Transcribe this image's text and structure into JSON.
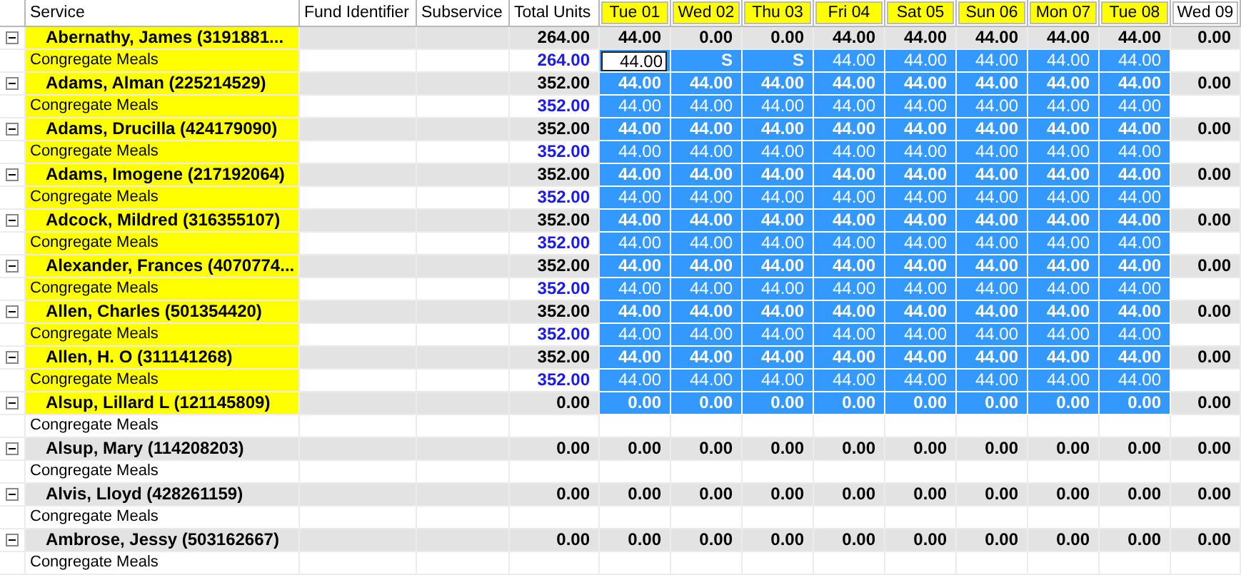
{
  "columns": {
    "service": "Service",
    "fund": "Fund Identifier",
    "subservice": "Subservice",
    "total": "Total Units"
  },
  "days": [
    {
      "label": "Tue 01",
      "highlighted": true
    },
    {
      "label": "Wed 02",
      "highlighted": true
    },
    {
      "label": "Thu 03",
      "highlighted": true
    },
    {
      "label": "Fri 04",
      "highlighted": true
    },
    {
      "label": "Sat 05",
      "highlighted": true
    },
    {
      "label": "Sun 06",
      "highlighted": true
    },
    {
      "label": "Mon 07",
      "highlighted": true
    },
    {
      "label": "Tue 08",
      "highlighted": true
    },
    {
      "label": "Wed 09",
      "highlighted": false
    }
  ],
  "groups": [
    {
      "name": "Abernathy, James (3191881...",
      "expanded": true,
      "highlighted": true,
      "total": "264.00",
      "cells": [
        {
          "value": "44.00",
          "selected": false
        },
        {
          "value": "0.00",
          "selected": false
        },
        {
          "value": "0.00",
          "selected": false
        },
        {
          "value": "44.00",
          "selected": false
        },
        {
          "value": "44.00",
          "selected": false
        },
        {
          "value": "44.00",
          "selected": false
        },
        {
          "value": "44.00",
          "selected": false
        },
        {
          "value": "44.00",
          "selected": false
        },
        {
          "value": "0.00",
          "selected": false
        }
      ],
      "detail": {
        "service": "Congregate Meals",
        "highlighted": true,
        "total": "264.00",
        "cells": [
          {
            "value": "44.00",
            "selected": true,
            "editing": true
          },
          {
            "value": "S",
            "selected": true
          },
          {
            "value": "S",
            "selected": true
          },
          {
            "value": "44.00",
            "selected": true
          },
          {
            "value": "44.00",
            "selected": true
          },
          {
            "value": "44.00",
            "selected": true
          },
          {
            "value": "44.00",
            "selected": true
          },
          {
            "value": "44.00",
            "selected": true
          },
          {
            "selected": false
          }
        ]
      }
    },
    {
      "name": "Adams, Alman (225214529)",
      "expanded": true,
      "highlighted": true,
      "total": "352.00",
      "cells": [
        {
          "value": "44.00",
          "selected": true
        },
        {
          "value": "44.00",
          "selected": true
        },
        {
          "value": "44.00",
          "selected": true
        },
        {
          "value": "44.00",
          "selected": true
        },
        {
          "value": "44.00",
          "selected": true
        },
        {
          "value": "44.00",
          "selected": true
        },
        {
          "value": "44.00",
          "selected": true
        },
        {
          "value": "44.00",
          "selected": true
        },
        {
          "value": "0.00",
          "selected": false
        }
      ],
      "detail": {
        "service": "Congregate Meals",
        "highlighted": true,
        "total": "352.00",
        "cells": [
          {
            "value": "44.00",
            "selected": true
          },
          {
            "value": "44.00",
            "selected": true
          },
          {
            "value": "44.00",
            "selected": true
          },
          {
            "value": "44.00",
            "selected": true
          },
          {
            "value": "44.00",
            "selected": true
          },
          {
            "value": "44.00",
            "selected": true
          },
          {
            "value": "44.00",
            "selected": true
          },
          {
            "value": "44.00",
            "selected": true
          },
          {
            "selected": false
          }
        ]
      }
    },
    {
      "name": "Adams, Drucilla (424179090)",
      "expanded": true,
      "highlighted": true,
      "total": "352.00",
      "cells": [
        {
          "value": "44.00",
          "selected": true
        },
        {
          "value": "44.00",
          "selected": true
        },
        {
          "value": "44.00",
          "selected": true
        },
        {
          "value": "44.00",
          "selected": true
        },
        {
          "value": "44.00",
          "selected": true
        },
        {
          "value": "44.00",
          "selected": true
        },
        {
          "value": "44.00",
          "selected": true
        },
        {
          "value": "44.00",
          "selected": true
        },
        {
          "value": "0.00",
          "selected": false
        }
      ],
      "detail": {
        "service": "Congregate Meals",
        "highlighted": true,
        "total": "352.00",
        "cells": [
          {
            "value": "44.00",
            "selected": true
          },
          {
            "value": "44.00",
            "selected": true
          },
          {
            "value": "44.00",
            "selected": true
          },
          {
            "value": "44.00",
            "selected": true
          },
          {
            "value": "44.00",
            "selected": true
          },
          {
            "value": "44.00",
            "selected": true
          },
          {
            "value": "44.00",
            "selected": true
          },
          {
            "value": "44.00",
            "selected": true
          },
          {
            "selected": false
          }
        ]
      }
    },
    {
      "name": "Adams, Imogene (217192064)",
      "expanded": true,
      "highlighted": true,
      "total": "352.00",
      "cells": [
        {
          "value": "44.00",
          "selected": true
        },
        {
          "value": "44.00",
          "selected": true
        },
        {
          "value": "44.00",
          "selected": true
        },
        {
          "value": "44.00",
          "selected": true
        },
        {
          "value": "44.00",
          "selected": true
        },
        {
          "value": "44.00",
          "selected": true
        },
        {
          "value": "44.00",
          "selected": true
        },
        {
          "value": "44.00",
          "selected": true
        },
        {
          "value": "0.00",
          "selected": false
        }
      ],
      "detail": {
        "service": "Congregate Meals",
        "highlighted": true,
        "total": "352.00",
        "cells": [
          {
            "value": "44.00",
            "selected": true
          },
          {
            "value": "44.00",
            "selected": true
          },
          {
            "value": "44.00",
            "selected": true
          },
          {
            "value": "44.00",
            "selected": true
          },
          {
            "value": "44.00",
            "selected": true
          },
          {
            "value": "44.00",
            "selected": true
          },
          {
            "value": "44.00",
            "selected": true
          },
          {
            "value": "44.00",
            "selected": true
          },
          {
            "selected": false
          }
        ]
      }
    },
    {
      "name": "Adcock, Mildred (316355107)",
      "expanded": true,
      "highlighted": true,
      "total": "352.00",
      "cells": [
        {
          "value": "44.00",
          "selected": true
        },
        {
          "value": "44.00",
          "selected": true
        },
        {
          "value": "44.00",
          "selected": true
        },
        {
          "value": "44.00",
          "selected": true
        },
        {
          "value": "44.00",
          "selected": true
        },
        {
          "value": "44.00",
          "selected": true
        },
        {
          "value": "44.00",
          "selected": true
        },
        {
          "value": "44.00",
          "selected": true
        },
        {
          "value": "0.00",
          "selected": false
        }
      ],
      "detail": {
        "service": "Congregate Meals",
        "highlighted": true,
        "total": "352.00",
        "cells": [
          {
            "value": "44.00",
            "selected": true
          },
          {
            "value": "44.00",
            "selected": true
          },
          {
            "value": "44.00",
            "selected": true
          },
          {
            "value": "44.00",
            "selected": true
          },
          {
            "value": "44.00",
            "selected": true
          },
          {
            "value": "44.00",
            "selected": true
          },
          {
            "value": "44.00",
            "selected": true
          },
          {
            "value": "44.00",
            "selected": true
          },
          {
            "selected": false
          }
        ]
      }
    },
    {
      "name": "Alexander, Frances (4070774...",
      "expanded": true,
      "highlighted": true,
      "total": "352.00",
      "cells": [
        {
          "value": "44.00",
          "selected": true
        },
        {
          "value": "44.00",
          "selected": true
        },
        {
          "value": "44.00",
          "selected": true
        },
        {
          "value": "44.00",
          "selected": true
        },
        {
          "value": "44.00",
          "selected": true
        },
        {
          "value": "44.00",
          "selected": true
        },
        {
          "value": "44.00",
          "selected": true
        },
        {
          "value": "44.00",
          "selected": true
        },
        {
          "value": "0.00",
          "selected": false
        }
      ],
      "detail": {
        "service": "Congregate Meals",
        "highlighted": true,
        "total": "352.00",
        "cells": [
          {
            "value": "44.00",
            "selected": true
          },
          {
            "value": "44.00",
            "selected": true
          },
          {
            "value": "44.00",
            "selected": true
          },
          {
            "value": "44.00",
            "selected": true
          },
          {
            "value": "44.00",
            "selected": true
          },
          {
            "value": "44.00",
            "selected": true
          },
          {
            "value": "44.00",
            "selected": true
          },
          {
            "value": "44.00",
            "selected": true
          },
          {
            "selected": false
          }
        ]
      }
    },
    {
      "name": "Allen, Charles (501354420)",
      "expanded": true,
      "highlighted": true,
      "total": "352.00",
      "cells": [
        {
          "value": "44.00",
          "selected": true
        },
        {
          "value": "44.00",
          "selected": true
        },
        {
          "value": "44.00",
          "selected": true
        },
        {
          "value": "44.00",
          "selected": true
        },
        {
          "value": "44.00",
          "selected": true
        },
        {
          "value": "44.00",
          "selected": true
        },
        {
          "value": "44.00",
          "selected": true
        },
        {
          "value": "44.00",
          "selected": true
        },
        {
          "value": "0.00",
          "selected": false
        }
      ],
      "detail": {
        "service": "Congregate Meals",
        "highlighted": true,
        "total": "352.00",
        "cells": [
          {
            "value": "44.00",
            "selected": true
          },
          {
            "value": "44.00",
            "selected": true
          },
          {
            "value": "44.00",
            "selected": true
          },
          {
            "value": "44.00",
            "selected": true
          },
          {
            "value": "44.00",
            "selected": true
          },
          {
            "value": "44.00",
            "selected": true
          },
          {
            "value": "44.00",
            "selected": true
          },
          {
            "value": "44.00",
            "selected": true
          },
          {
            "selected": false
          }
        ]
      }
    },
    {
      "name": "Allen, H. O (311141268)",
      "expanded": true,
      "highlighted": true,
      "total": "352.00",
      "cells": [
        {
          "value": "44.00",
          "selected": true
        },
        {
          "value": "44.00",
          "selected": true
        },
        {
          "value": "44.00",
          "selected": true
        },
        {
          "value": "44.00",
          "selected": true
        },
        {
          "value": "44.00",
          "selected": true
        },
        {
          "value": "44.00",
          "selected": true
        },
        {
          "value": "44.00",
          "selected": true
        },
        {
          "value": "44.00",
          "selected": true
        },
        {
          "value": "0.00",
          "selected": false
        }
      ],
      "detail": {
        "service": "Congregate Meals",
        "highlighted": true,
        "total": "352.00",
        "cells": [
          {
            "value": "44.00",
            "selected": true
          },
          {
            "value": "44.00",
            "selected": true
          },
          {
            "value": "44.00",
            "selected": true
          },
          {
            "value": "44.00",
            "selected": true
          },
          {
            "value": "44.00",
            "selected": true
          },
          {
            "value": "44.00",
            "selected": true
          },
          {
            "value": "44.00",
            "selected": true
          },
          {
            "value": "44.00",
            "selected": true
          },
          {
            "selected": false
          }
        ]
      }
    },
    {
      "name": "Alsup, Lillard L (121145809)",
      "expanded": true,
      "highlighted": true,
      "total": "0.00",
      "cells": [
        {
          "value": "0.00",
          "selected": true
        },
        {
          "value": "0.00",
          "selected": true
        },
        {
          "value": "0.00",
          "selected": true
        },
        {
          "value": "0.00",
          "selected": true
        },
        {
          "value": "0.00",
          "selected": true
        },
        {
          "value": "0.00",
          "selected": true
        },
        {
          "value": "0.00",
          "selected": true
        },
        {
          "value": "0.00",
          "selected": true
        },
        {
          "value": "0.00",
          "selected": false
        }
      ],
      "detail": {
        "service": "Congregate Meals",
        "highlighted": false,
        "cells": [
          {
            "selected": false
          },
          {
            "selected": false
          },
          {
            "selected": false
          },
          {
            "selected": false
          },
          {
            "selected": false
          },
          {
            "selected": false
          },
          {
            "selected": false
          },
          {
            "selected": false
          },
          {
            "selected": false
          }
        ]
      }
    },
    {
      "name": "Alsup, Mary (114208203)",
      "expanded": true,
      "highlighted": false,
      "total": "0.00",
      "cells": [
        {
          "value": "0.00",
          "selected": false
        },
        {
          "value": "0.00",
          "selected": false
        },
        {
          "value": "0.00",
          "selected": false
        },
        {
          "value": "0.00",
          "selected": false
        },
        {
          "value": "0.00",
          "selected": false
        },
        {
          "value": "0.00",
          "selected": false
        },
        {
          "value": "0.00",
          "selected": false
        },
        {
          "value": "0.00",
          "selected": false
        },
        {
          "value": "0.00",
          "selected": false
        }
      ],
      "detail": {
        "service": "Congregate Meals",
        "highlighted": false,
        "cells": [
          {
            "selected": false
          },
          {
            "selected": false
          },
          {
            "selected": false
          },
          {
            "selected": false
          },
          {
            "selected": false
          },
          {
            "selected": false
          },
          {
            "selected": false
          },
          {
            "selected": false
          },
          {
            "selected": false
          }
        ]
      }
    },
    {
      "name": "Alvis, Lloyd (428261159)",
      "expanded": true,
      "highlighted": false,
      "total": "0.00",
      "cells": [
        {
          "value": "0.00",
          "selected": false
        },
        {
          "value": "0.00",
          "selected": false
        },
        {
          "value": "0.00",
          "selected": false
        },
        {
          "value": "0.00",
          "selected": false
        },
        {
          "value": "0.00",
          "selected": false
        },
        {
          "value": "0.00",
          "selected": false
        },
        {
          "value": "0.00",
          "selected": false
        },
        {
          "value": "0.00",
          "selected": false
        },
        {
          "value": "0.00",
          "selected": false
        }
      ],
      "detail": {
        "service": "Congregate Meals",
        "highlighted": false,
        "cells": [
          {
            "selected": false
          },
          {
            "selected": false
          },
          {
            "selected": false
          },
          {
            "selected": false
          },
          {
            "selected": false
          },
          {
            "selected": false
          },
          {
            "selected": false
          },
          {
            "selected": false
          },
          {
            "selected": false
          }
        ]
      }
    },
    {
      "name": "Ambrose, Jessy (503162667)",
      "expanded": true,
      "highlighted": false,
      "total": "0.00",
      "cells": [
        {
          "value": "0.00",
          "selected": false
        },
        {
          "value": "0.00",
          "selected": false
        },
        {
          "value": "0.00",
          "selected": false
        },
        {
          "value": "0.00",
          "selected": false
        },
        {
          "value": "0.00",
          "selected": false
        },
        {
          "value": "0.00",
          "selected": false
        },
        {
          "value": "0.00",
          "selected": false
        },
        {
          "value": "0.00",
          "selected": false
        },
        {
          "value": "0.00",
          "selected": false
        }
      ],
      "detail": {
        "service": "Congregate Meals",
        "highlighted": false,
        "cells": [
          {
            "selected": false
          },
          {
            "selected": false
          },
          {
            "selected": false
          },
          {
            "selected": false
          },
          {
            "selected": false
          },
          {
            "selected": false
          },
          {
            "selected": false
          },
          {
            "selected": false
          },
          {
            "selected": false
          }
        ]
      }
    }
  ]
}
